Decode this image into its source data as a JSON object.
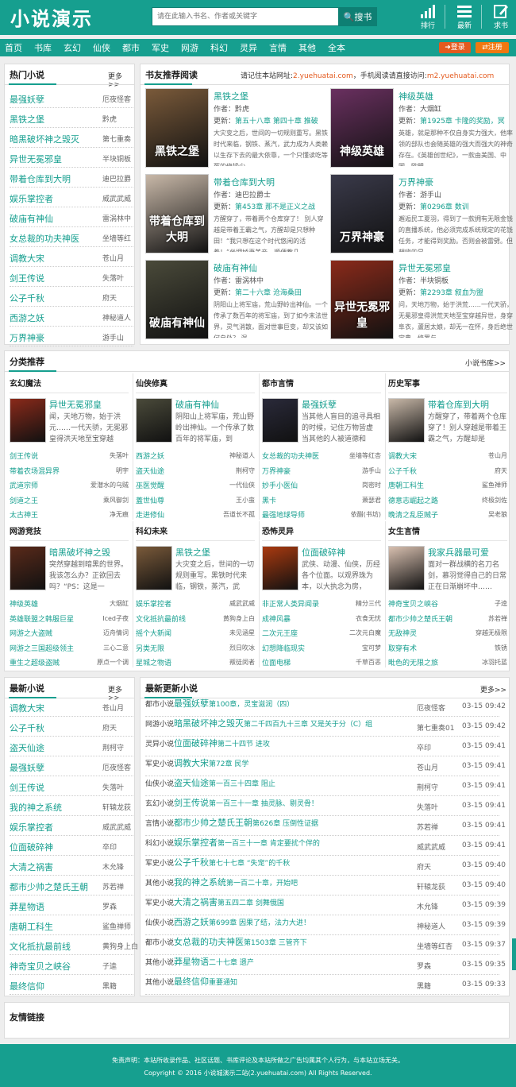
{
  "header": {
    "logo": "小说演示",
    "search_placeholder": "请在此输入书名、作者或关键字",
    "search_button": "搜书",
    "icons": [
      {
        "name": "rank-icon",
        "label": "排行"
      },
      {
        "name": "latest-icon",
        "label": "最新"
      },
      {
        "name": "request-icon",
        "label": "求书"
      }
    ]
  },
  "nav": {
    "items": [
      "首页",
      "书库",
      "玄幻",
      "仙侠",
      "都市",
      "军史",
      "网游",
      "科幻",
      "灵异",
      "言情",
      "其他",
      "全本"
    ],
    "login": "登录",
    "register": "注册"
  },
  "colors": {
    "accent": "#169f8f",
    "login": "#e45a1e",
    "register": "#f07810"
  },
  "hot": {
    "title": "热门小说",
    "more": "更多>>",
    "items": [
      [
        "最强妖孽",
        "厄夜怪客"
      ],
      [
        "黑铁之堡",
        "黔虎"
      ],
      [
        "暗黑破坏神之毁灭",
        "第七重奏"
      ],
      [
        "异世无冕邪皇",
        "半块铜板"
      ],
      [
        "带着仓库到大明",
        "迪巴拉爵"
      ],
      [
        "娱乐掌控者",
        "威武武威"
      ],
      [
        "破庙有神仙",
        "雷涡林中"
      ],
      [
        "女总裁的功夫神医",
        "坐墙等红"
      ],
      [
        "调教大宋",
        "苍山月"
      ],
      [
        "剑王传说",
        "失落叶"
      ],
      [
        "公子千秋",
        "府天"
      ],
      [
        "西游之妖",
        "神秘道人"
      ],
      [
        "万界神豪",
        "游手山"
      ]
    ]
  },
  "rec": {
    "title": "书友推荐阅读",
    "notice_pre": "请记住本站网址:",
    "url1": "2.yuehuatai.com",
    "notice_mid": "，手机阅读请直接访问:",
    "url2": "m2.yuehuatai.com",
    "items": [
      {
        "title": "黑铁之堡",
        "author": "作者：黔虎",
        "update": "第五十八章 第四十章 推破",
        "desc": "大灾变之后，世间的一切规则重写。黑铁时代来临，钢铁、蒸汽，武力成为人类赖以生存下去的最大依靠，一个只懂读吃等死的修操少",
        "cover": "黑铁之堡",
        "bg": "#7a5a3a"
      },
      {
        "title": "神级英雄",
        "author": "作者：大烟缸",
        "update": "第1925章 卡隆的奖励，冥",
        "desc": "英雄，就是那种不仅自身实力强大，他率领的部队也会随英雄的强大而强大的神奇存在。《英雄创世纪》，一款由美国、中国、欧盟、",
        "cover": "神级英雄",
        "bg": "#6a3060"
      },
      {
        "title": "带着仓库到大明",
        "author": "作者：迪巴拉爵士",
        "update": "第453章 那不是正义之战",
        "desc": "方醒穿了，带着两个仓库穿了！ 别人穿越是带着王霸之气，方醒却是只想种田！“我只想在这个时代悠闲的活着！”坐拥娇妻美妾，顺便教几",
        "cover": "带着仓库到大明",
        "bg": "#c8b8a8"
      },
      {
        "title": "万界神豪",
        "author": "作者：游手山",
        "update": "第0296章 数训",
        "desc": "邂逅民工夏羽，得到了一款拥有无限金钱的直播系统，他必须完成系统规定的花钱任务，才能得到奖励。否则会被雷劈。但想嗨的是，",
        "cover": "万界神豪",
        "bg": "#3a3a4a"
      },
      {
        "title": "破庙有神仙",
        "author": "作者：雷涡林中",
        "update": "第二十六章 沧海桑田",
        "desc": "阴阳山上将军庙，荒山野岭出神仙。一个传承了数百年的将军庙，到了如今末法世界，灵气消散，面对世事巨变，却又该如何自处？ 混",
        "cover": "破庙有神仙",
        "bg": "#4a4a3a"
      },
      {
        "title": "异世无冕邪皇",
        "author": "作者：半块铜板",
        "update": "第2293章 叙血为盟",
        "desc": "问，天地万物，始于洪荒……一代天骄，无冕邪皇得洪荒天地至宝穿越异世，身穿阜衣，蘆居太娘，却无一在怀，身后绝世宝典，修罗与",
        "cover": "异世无冕邪皇",
        "bg": "#8a2a1a"
      }
    ]
  },
  "cats": {
    "title": "分类推荐",
    "more": "小说书库>>",
    "groups": [
      {
        "name": "玄幻魔法",
        "title": "异世无冕邪皇",
        "desc": "闻，天地万物，始于洪元……一代天骄，无冕邪皇得洪天地至宝穿越",
        "cover": "异世无冕邪皇",
        "bg": "#8a2a1a",
        "rows": [
          [
            "剑王传说",
            "失落叶"
          ],
          [
            "带着农场混异界",
            "明宇"
          ],
          [
            "武道宗师",
            "爱潜水的乌贼"
          ],
          [
            "剑道之王",
            "乘风御剑"
          ],
          [
            "太古神王",
            "净无痕"
          ]
        ]
      },
      {
        "name": "仙侠修真",
        "title": "破庙有神仙",
        "desc": "阴阳山上将军庙，荒山野岭出神仙。一个传承了数百年的将军庙，到",
        "cover": "破庙有神仙",
        "bg": "#4a4a3a",
        "rows": [
          [
            "西游之妖",
            "神秘道人"
          ],
          [
            "盗天仙途",
            "荆柯守"
          ],
          [
            "巫医觉醒",
            "一代仙侠"
          ],
          [
            "蓋世仙尊",
            "王小蛮"
          ],
          [
            "走进修仙",
            "吾道长不孤"
          ]
        ]
      },
      {
        "name": "都市言情",
        "title": "最强妖孽",
        "desc": "当其他人盲目的追寻具相的时候，记住万物皆虚 当其他的人被道德和",
        "cover": "最强妖孽",
        "bg": "#2a2a3a",
        "rows": [
          [
            "女总裁的功夫神医",
            "坐墙等红杏"
          ],
          [
            "万界神豪",
            "游手山"
          ],
          [
            "妙手小医仙",
            "岗密时"
          ],
          [
            "黑卡",
            "萧瑟君"
          ],
          [
            "最强地球导师",
            "依醋(书坊)"
          ]
        ]
      },
      {
        "name": "历史军事",
        "title": "带着仓库到大明",
        "desc": "方醒穿了，带着两个仓库穿了！别人穿越是带着王霸之气，方醒却是",
        "cover": "带着仓库到大明",
        "bg": "#c8b8a8",
        "rows": [
          [
            "调教大宋",
            "苍山月"
          ],
          [
            "公子千秋",
            "府天"
          ],
          [
            "唐朝工科生",
            "鲨鱼禅师"
          ],
          [
            "德意志崛起之路",
            "终极剑佐"
          ],
          [
            "晚清之乱臣贼子",
            "吴老狼"
          ]
        ]
      },
      {
        "name": "网游竞技",
        "title": "暗黑破坏神之毁",
        "desc": "突然穿越到暗黑的世界。我该怎么办？正欲回去吗？“PS：这是一",
        "cover": "暗黑破坏神",
        "bg": "#5a2a1a",
        "rows": [
          [
            "神级英雄",
            "大烟缸"
          ],
          [
            "英雄联盟之韩服巨星",
            "Iced子夜"
          ],
          [
            "网游之大盗贼",
            "迈舟情词"
          ],
          [
            "网游之三国超级领主",
            "三心二意"
          ],
          [
            "重生之超级盗贼",
            "原点一个调"
          ]
        ]
      },
      {
        "name": "科幻未来",
        "title": "黑铁之堡",
        "desc": "大灾变之后，世间的一切规则重写。黑铁时代来临，钢铁，蒸汽，武",
        "cover": "黑铁之堡",
        "bg": "#7a5a3a",
        "rows": [
          [
            "娱乐掌控者",
            "威武武威"
          ],
          [
            "文化抵抗最前线",
            "黄狗身上白"
          ],
          [
            "摇个大新闻",
            "未见涵星"
          ],
          [
            "另类无限",
            "烈日吹冰"
          ],
          [
            "星城之物语",
            "叛徒闵者"
          ]
        ]
      },
      {
        "name": "恐怖灵异",
        "title": "位面破碎神",
        "desc": "武侠、动漫、仙侠，历经各个位面。以观界珠为本，以大执念为房，",
        "cover": "位面破碎神",
        "bg": "#aa3a10",
        "rows": [
          [
            "非正常人类异闻录",
            "精分三代"
          ],
          [
            "成神风暴",
            "衣食无忧"
          ],
          [
            "二次元王座",
            "二次元白魔"
          ],
          [
            "幻想降临现实",
            "宝可梦"
          ],
          [
            "位面电梯",
            "千草百恶"
          ]
        ]
      },
      {
        "name": "女生言情",
        "title": "我家兵器最可爱",
        "desc": "面对一群战横的名刀名剑，慕羽觉得自己的日常正在日渐崩坏中……",
        "cover": "我家兵器最可爱",
        "bg": "#d8c0b0",
        "rows": [
          [
            "神奇宝贝之峡谷",
            "子逵"
          ],
          [
            "都市少帅之楚氏王朝",
            "苏若禅"
          ],
          [
            "无敌神灵",
            "穿越无极限"
          ],
          [
            "取穿有术",
            "铁锈"
          ],
          [
            "毗色的无限之旅",
            "冰羽托蓝"
          ]
        ]
      }
    ]
  },
  "newest": {
    "title": "最新小说",
    "more": "更多>>",
    "items": [
      [
        "调教大宋",
        "苍山月"
      ],
      [
        "公子千秋",
        "府天"
      ],
      [
        "盗天仙途",
        "荆柯守"
      ],
      [
        "最强妖孽",
        "厄夜怪客"
      ],
      [
        "剑王传说",
        "失落叶"
      ],
      [
        "我的神之系统",
        "轩辕龙荻"
      ],
      [
        "娱乐掌控者",
        "威武武威"
      ],
      [
        "位面破碎神",
        "卒印"
      ],
      [
        "大清之祸害",
        "木允锋"
      ],
      [
        "都市少帅之楚氏王朝",
        "苏若禅"
      ],
      [
        "莽星物语",
        "罗森"
      ],
      [
        "唐朝工科生",
        "鲨鱼禅师"
      ],
      [
        "文化抵抗最前线",
        "黄狗身上白"
      ],
      [
        "神奇宝贝之峡谷",
        "子逵"
      ],
      [
        "最终信仰",
        "黑籍"
      ]
    ]
  },
  "updates": {
    "title": "最新更新小说",
    "more": "更多>>",
    "rows": [
      [
        "都市小说",
        "最强妖孽",
        "第100章，灵宝滋润（四）",
        "厄夜怪客",
        "03-15 09:42"
      ],
      [
        "网游小说",
        "暗黑破坏神之毁灭",
        "第二千四百九十三章 又是关于分（C）组",
        "第七重奏01",
        "03-15 09:42"
      ],
      [
        "灵异小说",
        "位面破碎神",
        "第二十四节 进攻",
        "卒印",
        "03-15 09:41"
      ],
      [
        "军史小说",
        "调教大宋",
        "第72章 民学",
        "苍山月",
        "03-15 09:41"
      ],
      [
        "仙侠小说",
        "盗天仙途",
        "第一百三十四章 阻止",
        "荆柯守",
        "03-15 09:41"
      ],
      [
        "玄幻小说",
        "剑王传说",
        "第一百三十一章 抽灵脉、剔灵骨！",
        "失落叶",
        "03-15 09:41"
      ],
      [
        "言情小说",
        "都市少帅之楚氏王朝",
        "第626章 压倒性证据",
        "苏若禅",
        "03-15 09:41"
      ],
      [
        "科幻小说",
        "娱乐掌控者",
        "第一百三十一章 肯定要扰个伴的",
        "威武武威",
        "03-15 09:41"
      ],
      [
        "军史小说",
        "公子千秋",
        "第七十七章 “失宠”的千秋",
        "府天",
        "03-15 09:40"
      ],
      [
        "其他小说",
        "我的神之系统",
        "第一百二十章，开始吧",
        "轩辕龙荻",
        "03-15 09:40"
      ],
      [
        "军史小说",
        "大清之祸害",
        "第五四二章 剑舞俄国",
        "木允锋",
        "03-15 09:39"
      ],
      [
        "仙侠小说",
        "西游之妖",
        "第699章 因果了结，法力大进！",
        "神秘道人",
        "03-15 09:39"
      ],
      [
        "都市小说",
        "女总裁的功夫神医",
        "第1503章 三管齐下",
        "坐墙等红杏",
        "03-15 09:37"
      ],
      [
        "其他小说",
        "莽星物语",
        "二十七章 遗产",
        "罗森",
        "03-15 09:35"
      ],
      [
        "其他小说",
        "最终信仰",
        "重要通知",
        "黑籍",
        "03-15 09:33"
      ]
    ]
  },
  "links": {
    "title": "友情链接"
  },
  "footer": {
    "line1": "免责声明：本站所收录作品、社区话题、书库评论及本站所做之广告均属其个人行为，与本站立场无关。",
    "line2": "Copyright © 2016 小说城演示二站(2.yuehuatai.com) All Rights Reserved."
  }
}
